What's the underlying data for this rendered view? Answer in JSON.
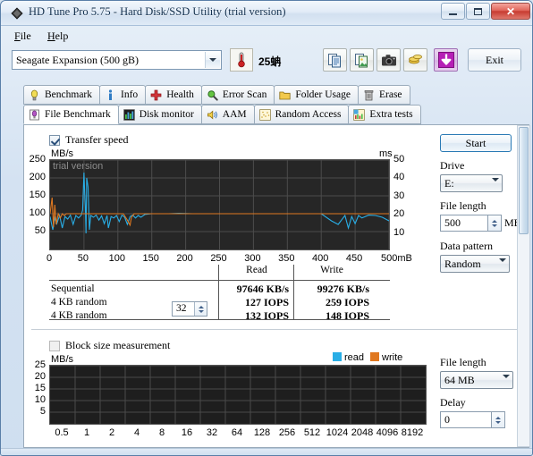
{
  "window": {
    "title": "HD Tune Pro 5.75 - Hard Disk/SSD Utility (trial version)",
    "icon": "hdtune-logo-icon",
    "minimize_label": "",
    "maximize_label": "",
    "close_label": "✕"
  },
  "menu": {
    "items": [
      {
        "label": "File",
        "mnemonic": "F",
        "rest": "ile"
      },
      {
        "label": "Help",
        "mnemonic": "H",
        "rest": "elp"
      }
    ]
  },
  "toolbar": {
    "drive_value": "Seagate Expansion (500 gB)",
    "temperature": "25蚺",
    "temperature_icon": "thermometer-icon",
    "buttons": [
      {
        "name": "copy-button",
        "icon": "copy-icon"
      },
      {
        "name": "copy-image-button",
        "icon": "copy-image-icon"
      },
      {
        "name": "screenshot-button",
        "icon": "camera-icon"
      },
      {
        "name": "donate-button",
        "icon": "coins-icon"
      },
      {
        "name": "save-button",
        "icon": "download-arrow-icon"
      }
    ],
    "exit_label": "Exit"
  },
  "tabs": {
    "row1": [
      {
        "label": "Benchmark",
        "icon": "lightbulb-icon",
        "active": false
      },
      {
        "label": "Info",
        "icon": "info-icon",
        "active": false
      },
      {
        "label": "Health",
        "icon": "red-cross-icon",
        "active": false
      },
      {
        "label": "Error Scan",
        "icon": "magnifier-icon",
        "active": false
      },
      {
        "label": "Folder Usage",
        "icon": "folder-icon",
        "active": false
      },
      {
        "label": "Erase",
        "icon": "trash-icon",
        "active": false
      }
    ],
    "row2": [
      {
        "label": "File Benchmark",
        "icon": "file-benchmark-icon",
        "active": true
      },
      {
        "label": "Disk monitor",
        "icon": "bar-chart-icon",
        "active": false
      },
      {
        "label": "AAM",
        "icon": "speaker-icon",
        "active": false
      },
      {
        "label": "Random Access",
        "icon": "scatter-icon",
        "active": false
      },
      {
        "label": "Extra tests",
        "icon": "grid-chart-icon",
        "active": false
      }
    ]
  },
  "file_benchmark": {
    "transfer_speed_label": "Transfer speed",
    "transfer_speed_checked": true,
    "block_size_label": "Block size measurement",
    "block_size_checked": false,
    "watermark": "trial version",
    "legend": [
      {
        "label": "read",
        "color": "#29aee6"
      },
      {
        "label": "write",
        "color": "#e07820"
      }
    ],
    "table": {
      "col_headers": [
        "Read",
        "Write"
      ],
      "rows": [
        {
          "label": "Sequential",
          "extra": null,
          "read": "97646 KB/s",
          "write": "99276 KB/s"
        },
        {
          "label": "4 KB random",
          "extra": null,
          "read": "127 IOPS",
          "write": "259 IOPS"
        },
        {
          "label": "4 KB random",
          "extra": "32",
          "read": "132 IOPS",
          "write": "148 IOPS"
        }
      ]
    },
    "controls": {
      "start_label": "Start",
      "drive_label": "Drive",
      "drive_value": "E:",
      "file_length_label": "File length",
      "file_length_value": "500",
      "file_length_unit": "MB",
      "data_pattern_label": "Data pattern",
      "data_pattern_value": "Random"
    },
    "block_controls": {
      "file_length_label": "File length",
      "file_length_value": "64 MB",
      "delay_label": "Delay",
      "delay_value": "0"
    }
  },
  "chart_data": [
    {
      "type": "line",
      "id": "transfer-speed-graph",
      "title": "",
      "ylabel": "MB/s",
      "y2label": "ms",
      "xlabel": "500mB",
      "ylim": [
        0,
        250
      ],
      "y2lim": [
        0,
        50
      ],
      "xlim": [
        0,
        500
      ],
      "yticks": [
        50,
        100,
        150,
        200,
        250
      ],
      "y2ticks": [
        10,
        20,
        30,
        40,
        50
      ],
      "xticks": [
        0,
        50,
        100,
        150,
        200,
        250,
        300,
        350,
        400,
        450,
        500
      ],
      "grid": true,
      "background": "#262626",
      "series": [
        {
          "name": "read",
          "color": "#29aee6",
          "x": [
            0,
            4,
            7,
            10,
            14,
            18,
            22,
            26,
            30,
            34,
            38,
            42,
            46,
            48,
            50,
            51,
            52,
            53,
            54,
            56,
            58,
            60,
            64,
            68,
            72,
            76,
            80,
            84,
            86,
            90,
            94,
            98,
            102,
            106,
            110,
            114,
            118,
            122,
            126,
            130,
            134,
            140,
            150,
            160,
            175,
            190,
            210,
            230,
            245,
            250,
            252,
            254,
            256,
            258,
            262,
            270,
            285,
            300,
            320,
            340,
            360,
            380,
            400,
            415,
            425,
            435,
            440,
            445,
            450,
            455,
            460,
            470,
            480,
            490,
            500
          ],
          "y": [
            92,
            55,
            88,
            72,
            95,
            60,
            92,
            85,
            96,
            70,
            95,
            88,
            96,
            110,
            215,
            160,
            120,
            45,
            200,
            175,
            55,
            95,
            90,
            96,
            82,
            94,
            72,
            95,
            60,
            92,
            88,
            95,
            78,
            96,
            90,
            70,
            92,
            96,
            88,
            95,
            90,
            98,
            100,
            100,
            100,
            101,
            100,
            100,
            100,
            100,
            100,
            100,
            100,
            100,
            100,
            100,
            100,
            100,
            100,
            100,
            100,
            100,
            100,
            80,
            70,
            95,
            60,
            92,
            72,
            95,
            88,
            96,
            95,
            90,
            80
          ]
        },
        {
          "name": "write",
          "color": "#e07820",
          "x": [
            0,
            3,
            5,
            7,
            9,
            12,
            15,
            18,
            21,
            24,
            28,
            32,
            36,
            40,
            44,
            48,
            52,
            56,
            60,
            66,
            72,
            78,
            84,
            90,
            96,
            102,
            108,
            114,
            118,
            120,
            124,
            128,
            132,
            136,
            140,
            150,
            170,
            200,
            230,
            260,
            290,
            320,
            350,
            380,
            410,
            440,
            470,
            500
          ],
          "y": [
            100,
            145,
            62,
            125,
            70,
            100,
            88,
            100,
            95,
            100,
            100,
            100,
            100,
            100,
            100,
            100,
            100,
            100,
            100,
            100,
            100,
            100,
            100,
            100,
            100,
            100,
            100,
            82,
            68,
            90,
            100,
            100,
            100,
            100,
            100,
            100,
            100,
            100,
            100,
            100,
            100,
            100,
            100,
            100,
            100,
            100,
            100,
            100
          ]
        }
      ]
    },
    {
      "type": "bar",
      "id": "block-size-graph",
      "title": "",
      "ylabel": "MB/s",
      "ylim": [
        0,
        25
      ],
      "yticks": [
        5,
        10,
        15,
        20,
        25
      ],
      "categories": [
        "0.5",
        "1",
        "2",
        "4",
        "8",
        "16",
        "32",
        "64",
        "128",
        "256",
        "512",
        "1024",
        "2048",
        "4096",
        "8192"
      ],
      "series": [
        {
          "name": "read",
          "color": "#29aee6",
          "values": [
            0,
            0,
            0,
            0,
            0,
            0,
            0,
            0,
            0,
            0,
            0,
            0,
            0,
            0,
            0
          ]
        },
        {
          "name": "write",
          "color": "#e07820",
          "values": [
            0,
            0,
            0,
            0,
            0,
            0,
            0,
            0,
            0,
            0,
            0,
            0,
            0,
            0,
            0
          ]
        }
      ],
      "grid": true,
      "background": "#1e1e1e"
    }
  ]
}
